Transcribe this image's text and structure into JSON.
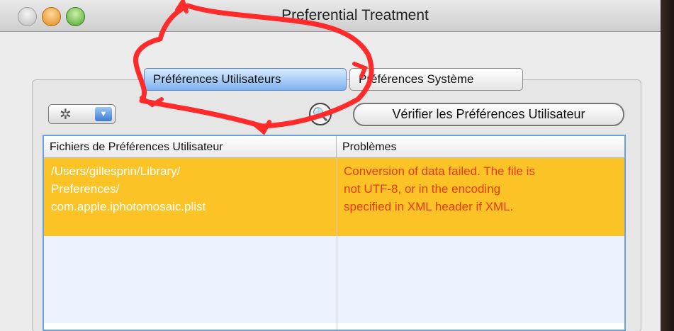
{
  "window": {
    "title": "Preferential Treatment"
  },
  "tabs": [
    {
      "label": "Préférences Utilisateurs",
      "selected": true
    },
    {
      "label": "Préférences Système",
      "selected": false
    }
  ],
  "toolbar": {
    "action_icon": "gear-icon",
    "verify_label": "Vérifier les Préférences Utilisateur"
  },
  "table": {
    "headers": [
      "Fichiers de Préférences Utilisateur",
      "Problèmes"
    ],
    "rows": [
      {
        "file_lines": [
          "/Users/gillesprin/Library/",
          "Preferences/",
          "com.apple.iphotomosaic.plist"
        ],
        "problem_lines": [
          "Conversion of data failed. The file is",
          "not UTF-8, or in the encoding",
          "specified in XML header if XML."
        ]
      }
    ]
  },
  "colors": {
    "selected_row": "#fbc326",
    "problem_text": "#e03c10",
    "annotation": "#ff2a2a"
  }
}
